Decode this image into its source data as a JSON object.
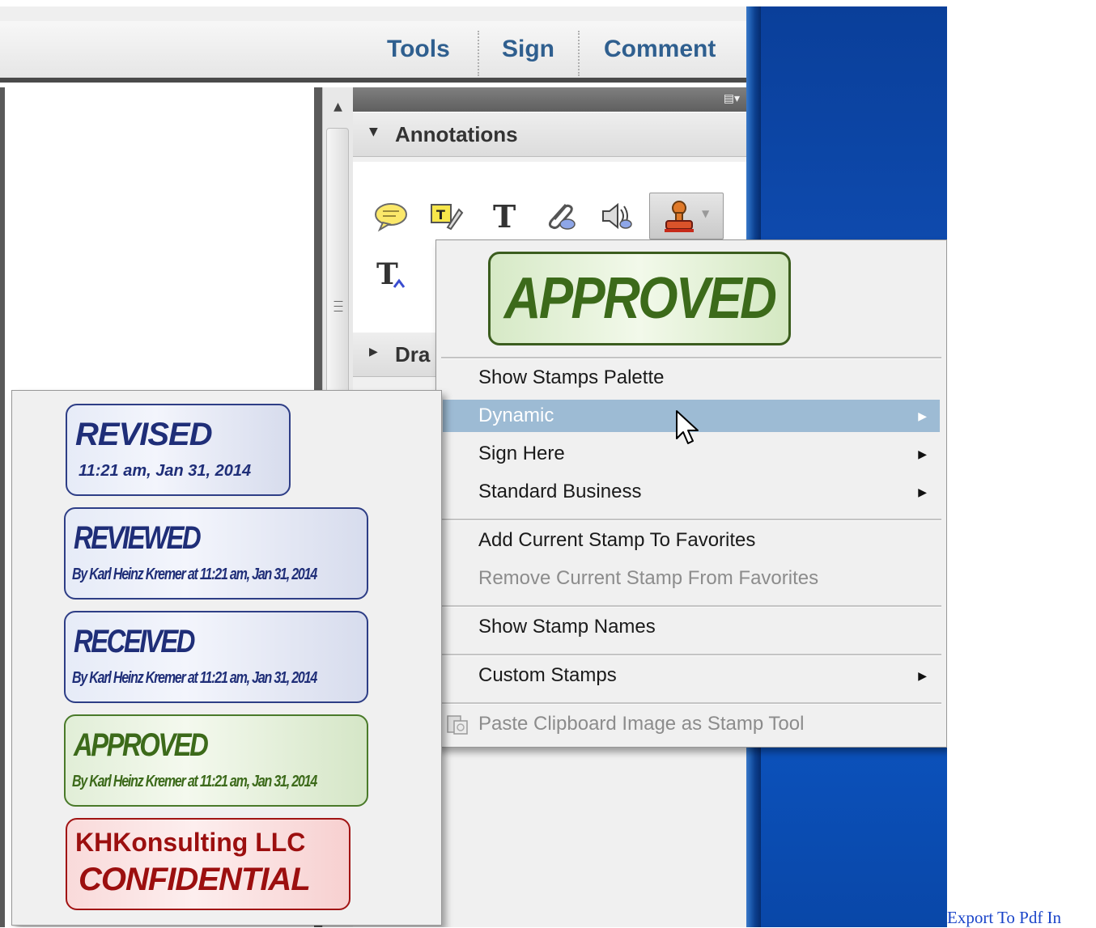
{
  "toolbar": {
    "tabs": [
      "Tools",
      "Sign",
      "Comment"
    ]
  },
  "panel": {
    "sections": [
      {
        "label": "Annotations",
        "expanded": true
      },
      {
        "label": "Dra",
        "expanded": false
      }
    ],
    "annotation_tools": [
      "sticky-note-icon",
      "highlight-text-icon",
      "add-text-icon",
      "attach-file-icon",
      "record-audio-icon",
      "stamp-icon",
      "text-correction-icon"
    ]
  },
  "stamp_menu": {
    "preview": "APPROVED",
    "items": [
      {
        "label": "Show Stamps Palette",
        "submenu": false,
        "highlighted": false,
        "disabled": false
      },
      {
        "label": "Dynamic",
        "submenu": true,
        "highlighted": true,
        "disabled": false
      },
      {
        "label": "Sign Here",
        "submenu": true,
        "highlighted": false,
        "disabled": false
      },
      {
        "label": "Standard Business",
        "submenu": true,
        "highlighted": false,
        "disabled": false
      },
      {
        "label": "Add Current Stamp To Favorites",
        "submenu": false,
        "highlighted": false,
        "disabled": false
      },
      {
        "label": "Remove Current Stamp From Favorites",
        "submenu": false,
        "highlighted": false,
        "disabled": true
      },
      {
        "label": "Show Stamp Names",
        "submenu": false,
        "highlighted": false,
        "disabled": false
      },
      {
        "label": "Custom Stamps",
        "submenu": true,
        "highlighted": false,
        "disabled": false
      },
      {
        "label": "Paste Clipboard Image as Stamp Tool",
        "submenu": false,
        "highlighted": false,
        "disabled": true,
        "icon": "clipboard-icon"
      }
    ]
  },
  "dynamic_stamps": [
    {
      "title": "REVISED",
      "subtitle": "11:21 am, Jan 31, 2014",
      "color": "#1f2e78"
    },
    {
      "title": "REVIEWED",
      "subtitle": "By Karl Heinz Kremer at 11:21 am, Jan 31, 2014",
      "color": "#1f2e78"
    },
    {
      "title": "RECEIVED",
      "subtitle": "By Karl Heinz Kremer at 11:21 am, Jan 31, 2014",
      "color": "#1f2e78"
    },
    {
      "title": "APPROVED",
      "subtitle": "By Karl Heinz Kremer at 11:21 am, Jan 31, 2014",
      "color": "#3c6a1a"
    },
    {
      "title": "KHKonsulting LLC",
      "subtitle": "CONFIDENTIAL",
      "color": "#9c0f0f"
    }
  ],
  "footer_link": "Export To Pdf In"
}
